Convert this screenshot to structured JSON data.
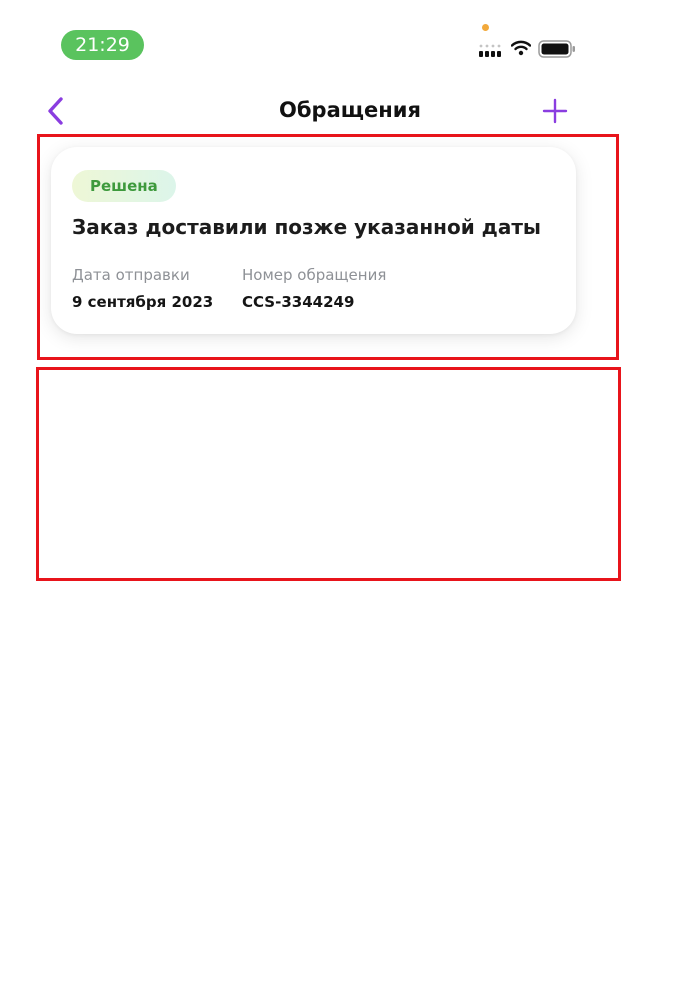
{
  "status_bar": {
    "time": "21:29",
    "icons": [
      "signal-icon",
      "wifi-icon",
      "battery-icon"
    ]
  },
  "nav": {
    "title": "Обращения",
    "back_icon": "chevron-left-icon",
    "add_icon": "plus-icon"
  },
  "ticket": {
    "status": "Решена",
    "title": "Заказ доставили позже указанной даты",
    "fields": [
      {
        "label": "Дата отправки",
        "value": "9 сентября 2023"
      },
      {
        "label": "Номер обращения",
        "value": "CCS-3344249"
      }
    ]
  },
  "colors": {
    "accent": "#8a3de0",
    "time_pill": "#5ac35e",
    "status_text": "#3e9a3d",
    "annotation": "#e8141b"
  }
}
